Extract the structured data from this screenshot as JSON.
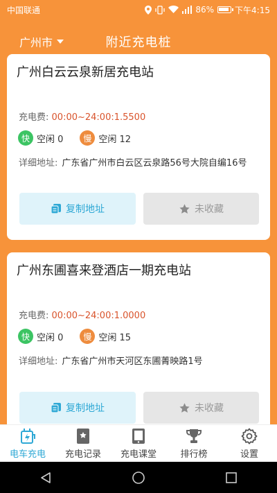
{
  "status_bar": {
    "carrier": "中国联通",
    "battery_percent": "86%",
    "time": "下午4:15",
    "icons": [
      "location-icon",
      "vibrate-icon",
      "wifi-icon",
      "signal-icon",
      "battery-icon"
    ]
  },
  "header": {
    "city": "广州市",
    "title": "附近充电桩"
  },
  "stations": [
    {
      "name": "广州白云云泉新居充电站",
      "fee_label": "充电费:",
      "fee_value": "00:00~24:00:1.5500",
      "fast_badge": "快",
      "fast_text": "空闲 0",
      "slow_badge": "慢",
      "slow_text": "空闲 12",
      "address_label": "详细地址:",
      "address": "广东省广州市白云区云泉路56号大院自编16号",
      "copy_label": "复制地址",
      "fav_label": "未收藏"
    },
    {
      "name": "广州东圃喜来登酒店一期充电站",
      "fee_label": "充电费:",
      "fee_value": "00:00~24:00:1.0000",
      "fast_badge": "快",
      "fast_text": "空闲 0",
      "slow_badge": "慢",
      "slow_text": "空闲 15",
      "address_label": "详细地址:",
      "address": "广东省广州市天河区东圃菁映路1号",
      "copy_label": "复制地址",
      "fav_label": "未收藏"
    }
  ],
  "bottom_nav": [
    {
      "label": "电车充电",
      "icon": "charging-plug-icon",
      "active": true
    },
    {
      "label": "充电记录",
      "icon": "bookmark-record-icon",
      "active": false
    },
    {
      "label": "充电课堂",
      "icon": "tablet-icon",
      "active": false
    },
    {
      "label": "排行榜",
      "icon": "trophy-icon",
      "active": false
    },
    {
      "label": "设置",
      "icon": "settings-gear-icon",
      "active": false
    }
  ],
  "colors": {
    "background": "#F7933A",
    "accent": "#2EA8D5",
    "fee": "#D9532B",
    "fast": "#3CC463",
    "slow": "#EE8C3E"
  }
}
